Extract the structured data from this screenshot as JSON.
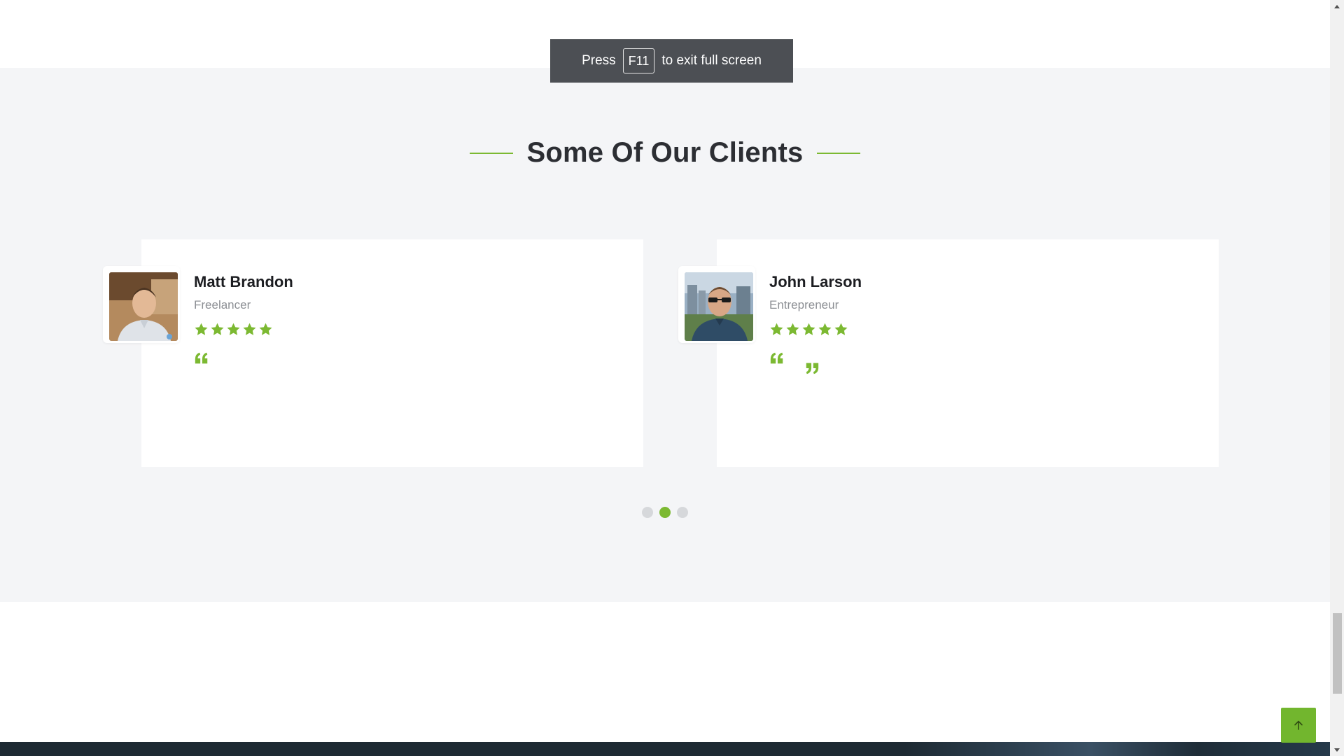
{
  "fullscreen_toast": {
    "before": "Press",
    "key": "F11",
    "after": "to exit full screen"
  },
  "clients_section": {
    "title": "Some Of Our Clients",
    "testimonials": [
      {
        "name": "Matt Brandon",
        "role": "Freelancer",
        "rating": 5,
        "avatar_icon": "person-portrait-icon"
      },
      {
        "name": "John Larson",
        "role": "Entrepreneur",
        "rating": 5,
        "avatar_icon": "person-portrait-icon"
      }
    ],
    "slider": {
      "total_pages": 3,
      "active_page": 2
    }
  },
  "colors": {
    "accent": "#7cb932",
    "section_background": "#f4f5f7",
    "heading_text": "#2c2e33",
    "muted_text": "#8c8f94",
    "toast_background": "#4c4f54",
    "footer_dark": "#1e2a33"
  },
  "back_to_top": {
    "icon": "arrow-up-icon"
  }
}
